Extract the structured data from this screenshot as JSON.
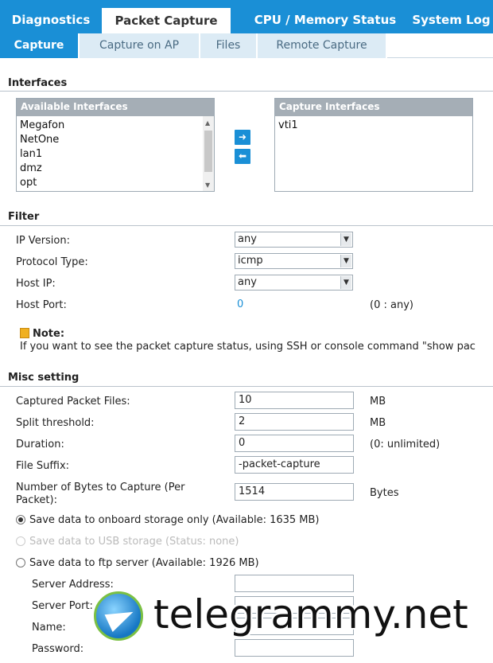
{
  "top_tabs": [
    {
      "label": "Diagnostics"
    },
    {
      "label": "Packet Capture"
    },
    {
      "label": "CPU / Memory Status"
    },
    {
      "label": "System Log"
    }
  ],
  "sub_tabs": [
    {
      "label": "Capture"
    },
    {
      "label": "Capture on AP"
    },
    {
      "label": "Files"
    },
    {
      "label": "Remote Capture"
    }
  ],
  "interfaces": {
    "title": "Interfaces",
    "available_header": "Available Interfaces",
    "available_items": [
      "Megafon",
      "NetOne",
      "lan1",
      "dmz",
      "opt"
    ],
    "capture_header": "Capture Interfaces",
    "capture_items": [
      "vti1"
    ],
    "move_right": "➜",
    "move_left": "⬅"
  },
  "filter": {
    "title": "Filter",
    "ip_version_label": "IP Version:",
    "ip_version_value": "any",
    "protocol_label": "Protocol Type:",
    "protocol_value": "icmp",
    "host_ip_label": "Host IP:",
    "host_ip_value": "any",
    "host_port_label": "Host Port:",
    "host_port_value": "0",
    "host_port_hint": "(0 : any)"
  },
  "note": {
    "title": "Note:",
    "text": "If you want to see the packet capture status, using SSH or console command \"show pac"
  },
  "misc": {
    "title": "Misc setting",
    "captured_files_label": "Captured Packet Files:",
    "captured_files_value": "10",
    "captured_files_unit": "MB",
    "split_label": "Split threshold:",
    "split_value": "2",
    "split_unit": "MB",
    "duration_label": "Duration:",
    "duration_value": "0",
    "duration_hint": "(0: unlimited)",
    "suffix_label": "File Suffix:",
    "suffix_value": "-packet-capture",
    "bytes_label_1": "Number of Bytes to Capture (Per",
    "bytes_label_2": "Packet):",
    "bytes_value": "1514",
    "bytes_unit": "Bytes",
    "radio_onboard": "Save data to onboard storage only (Available: 1635 MB)",
    "radio_usb": "Save data to USB storage (Status: none)",
    "radio_ftp": "Save data to ftp server (Available: 1926 MB)",
    "server_address_label": "Server Address:",
    "server_port_label": "Server Port:",
    "name_label": "Name:",
    "password_label": "Password:"
  },
  "watermark": {
    "text": "telegrammy.net"
  },
  "colors": {
    "accent": "#1a8fd6",
    "list_header": "#a5aeb6"
  }
}
